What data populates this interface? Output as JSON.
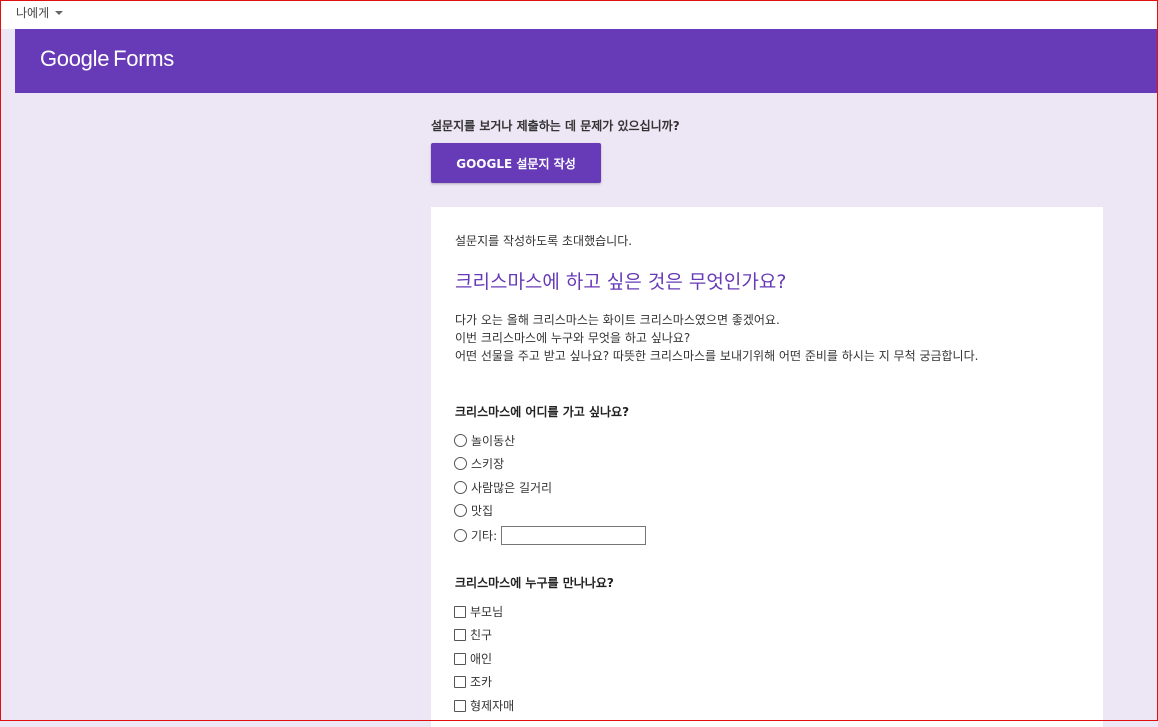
{
  "top_bar": {
    "to_me_label": "나에게"
  },
  "header": {
    "logo_google": "Google",
    "logo_forms": "Forms",
    "background_color": "#673ab7"
  },
  "help": {
    "trouble_text": "설문지를 보거나 제출하는 데 문제가 있으십니까?",
    "create_button_label": "GOOGLE 설문지 작성"
  },
  "form": {
    "invite_text": "설문지를 작성하도록 초대했습니다.",
    "title": "크리스마스에 하고 싶은 것은 무엇인가요?",
    "description": [
      "다가 오는 올해 크리스마스는 화이트 크리스마스였으면 좋겠어요.",
      "이번 크리스마스에 누구와 무엇을 하고 싶나요?",
      "어떤 선물을 주고 받고 싶나요? 따뜻한 크리스마스를 보내기위해 어떤 준비를 하시는 지 무척 궁금합니다."
    ],
    "questions": [
      {
        "title": "크리스마스에 어디를 가고 싶나요?",
        "type": "radio",
        "options": [
          "놀이동산",
          "스키장",
          "사람많은 길거리",
          "맛집"
        ],
        "other_label": "기타:",
        "other_value": ""
      },
      {
        "title": "크리스마스에 누구를 만나나요?",
        "type": "checkbox",
        "options": [
          "부모님",
          "친구",
          "애인",
          "조카",
          "형제자매"
        ]
      }
    ]
  }
}
